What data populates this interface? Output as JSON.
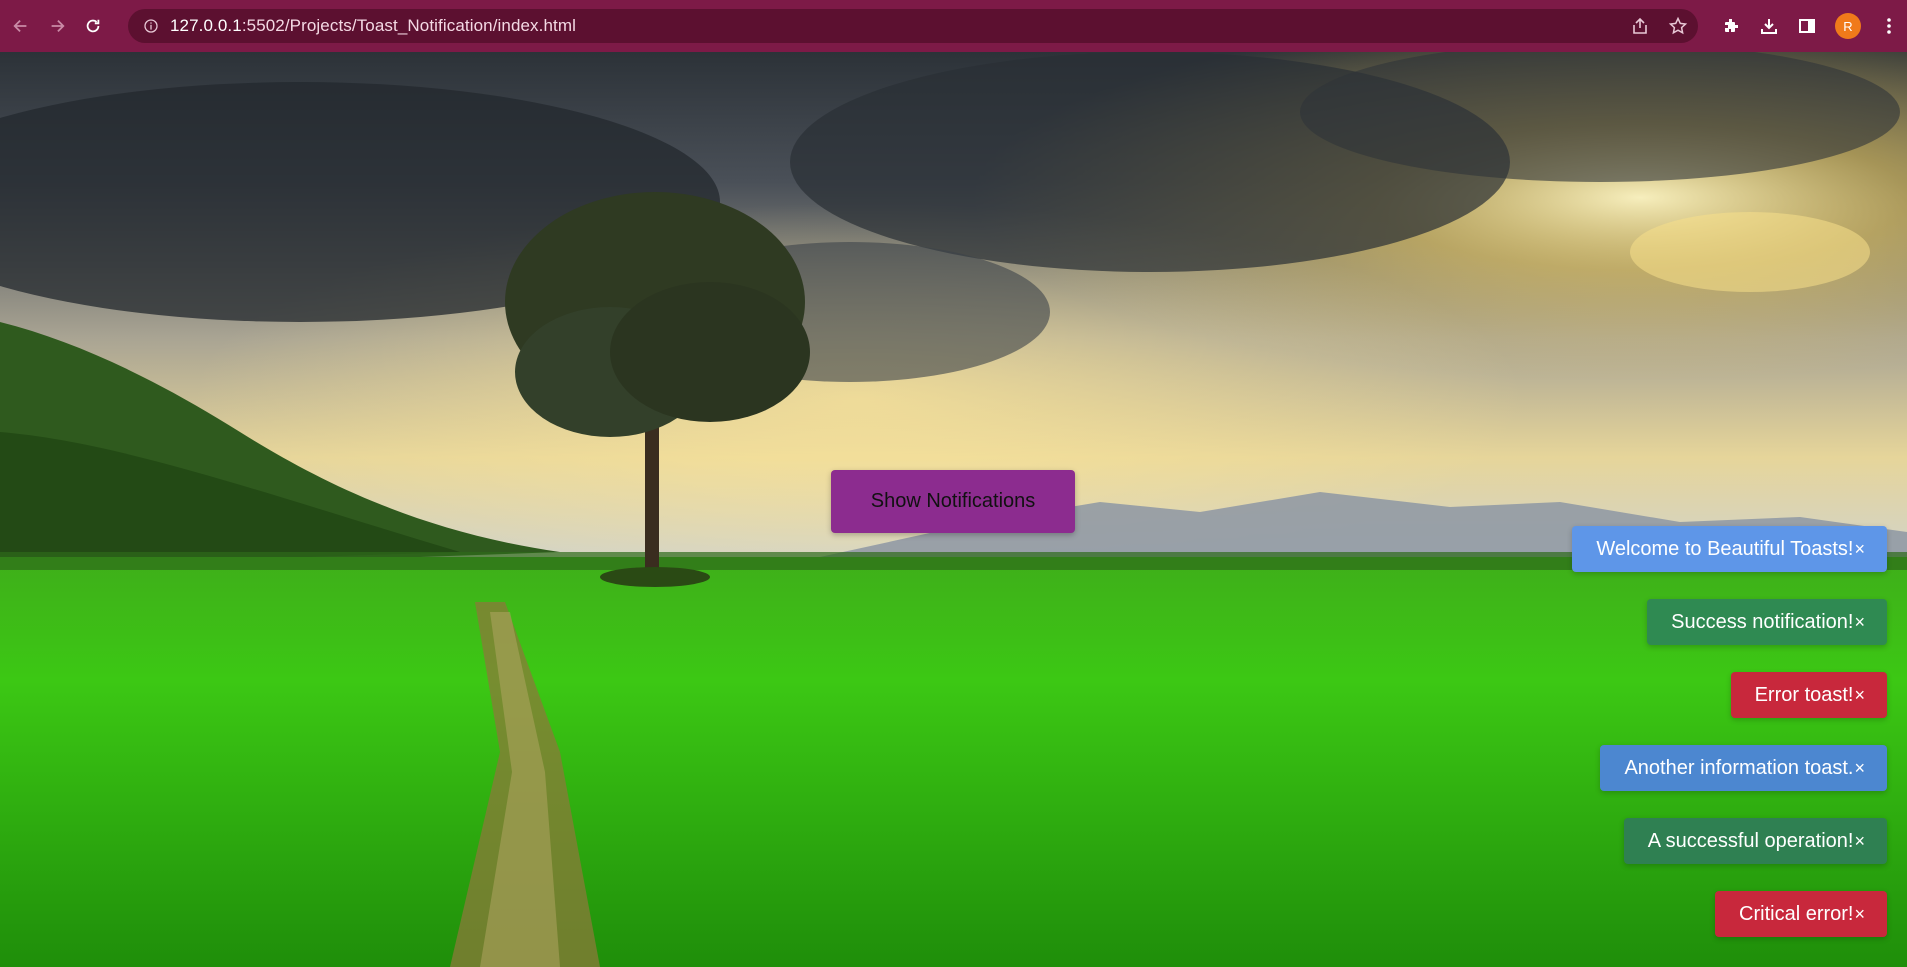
{
  "browser": {
    "url_host": "127.0.0.1",
    "url_rest": ":5502/Projects/Toast_Notification/index.html",
    "profile_initial": "R",
    "icons": [
      "back-icon",
      "forward-icon",
      "reload-icon",
      "info-icon",
      "share-icon",
      "star-icon",
      "extensions-icon",
      "download-icon",
      "sidepanel-icon",
      "menu-icon"
    ]
  },
  "page": {
    "button_label": "Show Notifications",
    "toasts": [
      {
        "text": "Welcome to Beautiful Toasts!",
        "close": "×",
        "type": "info",
        "color": "#5e96e8"
      },
      {
        "text": "Success notification!",
        "close": "×",
        "type": "success",
        "color": "#2f8a52"
      },
      {
        "text": "Error toast!",
        "close": "×",
        "type": "error",
        "color": "#c8283c"
      },
      {
        "text": "Another information toast.",
        "close": "×",
        "type": "info",
        "color": "#4c87d0"
      },
      {
        "text": "A successful operation!",
        "close": "×",
        "type": "success",
        "color": "#2f8052"
      },
      {
        "text": "Critical error!",
        "close": "×",
        "type": "error",
        "color": "#c8283c"
      }
    ]
  },
  "colors": {
    "chrome": "#7d1a47",
    "omnibox": "#5c1030",
    "button": "#8c2c8f"
  }
}
